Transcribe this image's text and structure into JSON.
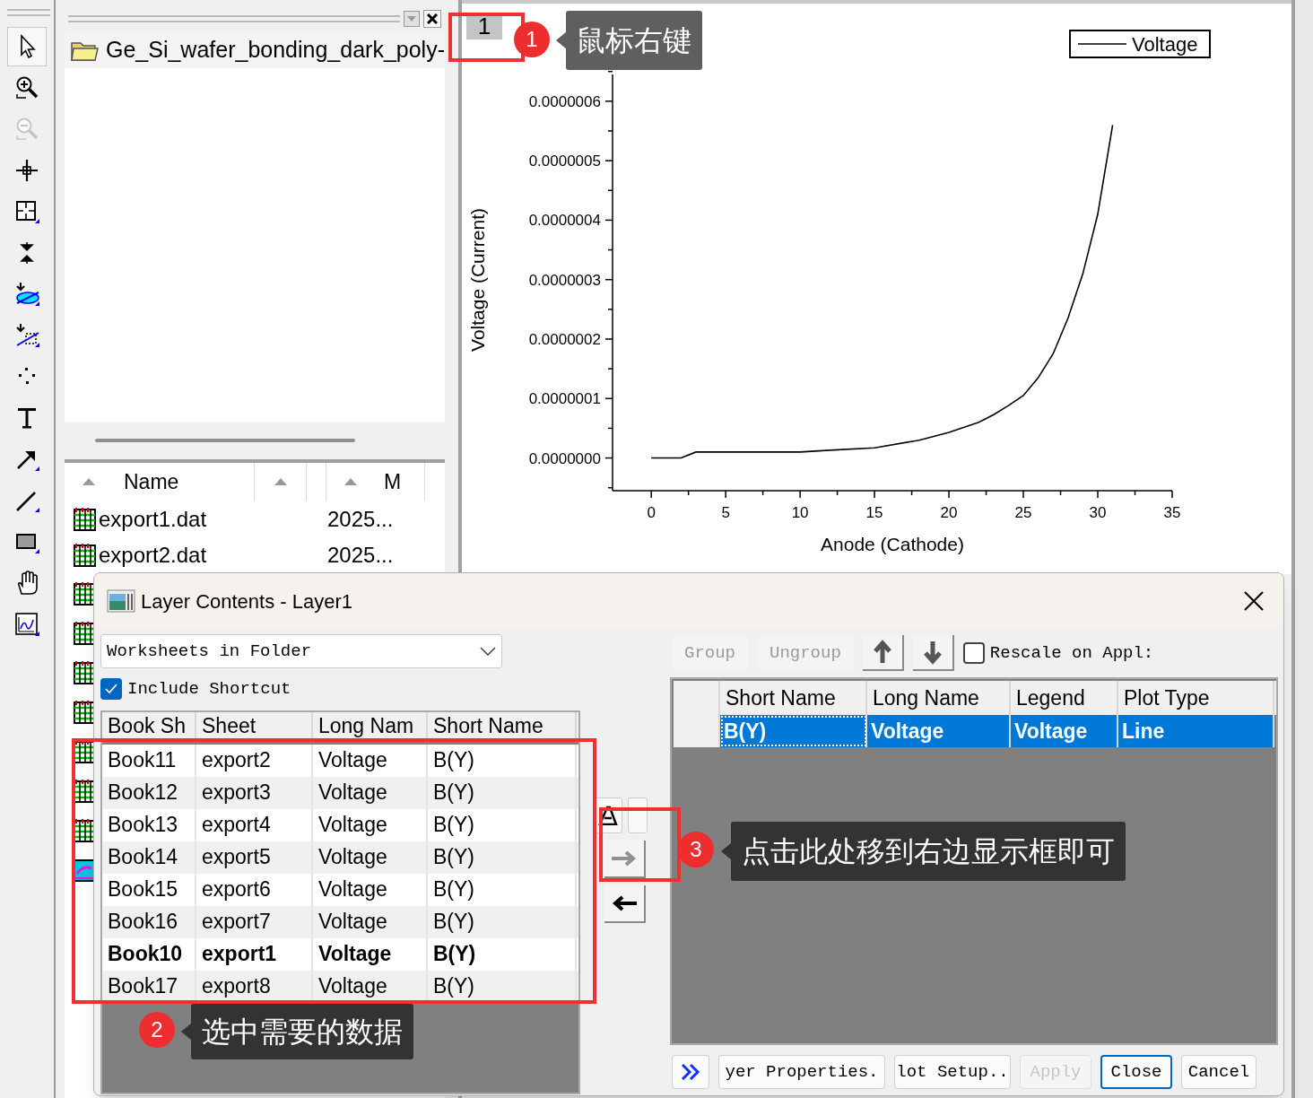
{
  "toolbar": {
    "tools": [
      {
        "kind": "pointer",
        "selected": true,
        "disabled": false
      },
      {
        "kind": "zoom_in",
        "selected": false,
        "disabled": false
      },
      {
        "kind": "zoom_out",
        "selected": false,
        "disabled": true
      },
      {
        "kind": "crosshair",
        "selected": false,
        "disabled": false
      },
      {
        "kind": "scale",
        "selected": false,
        "disabled": false
      },
      {
        "kind": "join",
        "selected": false,
        "disabled": false
      },
      {
        "kind": "ellipse",
        "selected": false,
        "disabled": false
      },
      {
        "kind": "region",
        "selected": false,
        "disabled": false
      },
      {
        "kind": "dots",
        "selected": false,
        "disabled": false
      },
      {
        "kind": "text",
        "selected": false,
        "disabled": false
      },
      {
        "kind": "arrow",
        "selected": false,
        "disabled": false
      },
      {
        "kind": "line",
        "selected": false,
        "disabled": false
      },
      {
        "kind": "rectangle",
        "selected": false,
        "disabled": false
      },
      {
        "kind": "hand",
        "selected": false,
        "disabled": false
      },
      {
        "kind": "chart",
        "selected": false,
        "disabled": false
      }
    ]
  },
  "project_explorer": {
    "folder": "Ge_Si_wafer_bonding_dark_poly-",
    "columns": [
      "Name",
      "M"
    ],
    "files": [
      {
        "name": "export1.dat",
        "modified": "2025..."
      },
      {
        "name": "export2.dat",
        "modified": "2025..."
      }
    ],
    "more_items": [
      {
        "kind": "worksheet"
      },
      {
        "kind": "worksheet"
      },
      {
        "kind": "worksheet"
      },
      {
        "kind": "worksheet"
      },
      {
        "kind": "worksheet"
      },
      {
        "kind": "worksheet"
      },
      {
        "kind": "worksheet"
      },
      {
        "kind": "graph"
      }
    ]
  },
  "graph": {
    "layer_tab": "1",
    "chart_data": {
      "type": "line",
      "xlabel": "Anode (Cathode)",
      "ylabel": "Voltage (Current)",
      "x": [
        0,
        2,
        3,
        5,
        10,
        12,
        15,
        18,
        20,
        22,
        23,
        24,
        25,
        26,
        27,
        28,
        29,
        30,
        31
      ],
      "series": [
        {
          "name": "Voltage",
          "color": "#000000",
          "values": [
            0,
            0,
            1e-08,
            1e-08,
            1e-08,
            1.3e-08,
            1.7e-08,
            3e-08,
            4.3e-08,
            6e-08,
            7.3e-08,
            8.8e-08,
            1.05e-07,
            1.35e-07,
            1.75e-07,
            2.35e-07,
            3.1e-07,
            4.1e-07,
            5.6e-07
          ]
        }
      ],
      "xlim": [
        -2.6,
        35
      ],
      "ylim": [
        -5.5e-08,
        6.45e-07
      ],
      "xticks": [
        0,
        5,
        10,
        15,
        20,
        25,
        30,
        35
      ],
      "yticks": [
        {
          "value": 0,
          "label": "0.0000000"
        },
        {
          "value": 1e-07,
          "label": "0.0000001"
        },
        {
          "value": 2e-07,
          "label": "0.0000002"
        },
        {
          "value": 3e-07,
          "label": "0.0000003"
        },
        {
          "value": 4e-07,
          "label": "0.0000004"
        },
        {
          "value": 5e-07,
          "label": "0.0000005"
        },
        {
          "value": 6e-07,
          "label": "0.0000006"
        }
      ]
    }
  },
  "dialog": {
    "title": "Layer Contents - Layer1",
    "source": "Worksheets in Folder",
    "include_shortcut": {
      "label": "Include Shortcut",
      "checked": true
    },
    "available": {
      "columns": [
        "Book Sh",
        "Sheet",
        "Long Nam",
        "Short Name"
      ],
      "rows": [
        {
          "cells": [
            "Book11",
            "export2",
            "Voltage",
            "B(Y)"
          ],
          "bold": false
        },
        {
          "cells": [
            "Book12",
            "export3",
            "Voltage",
            "B(Y)"
          ],
          "bold": false
        },
        {
          "cells": [
            "Book13",
            "export4",
            "Voltage",
            "B(Y)"
          ],
          "bold": false
        },
        {
          "cells": [
            "Book14",
            "export5",
            "Voltage",
            "B(Y)"
          ],
          "bold": false
        },
        {
          "cells": [
            "Book15",
            "export6",
            "Voltage",
            "B(Y)"
          ],
          "bold": false
        },
        {
          "cells": [
            "Book16",
            "export7",
            "Voltage",
            "B(Y)"
          ],
          "bold": false
        },
        {
          "cells": [
            "Book10",
            "export1",
            "Voltage",
            "B(Y)"
          ],
          "bold": true
        },
        {
          "cells": [
            "Book17",
            "export8",
            "Voltage",
            "B(Y)"
          ],
          "bold": false
        }
      ]
    },
    "transfer_buttons": [
      {
        "kind": "add",
        "disabled": true
      },
      {
        "kind": "remove",
        "disabled": false
      }
    ],
    "group_buttons": [
      {
        "label": "Group",
        "disabled": true
      },
      {
        "label": "Ungroup",
        "disabled": true
      }
    ],
    "order_buttons": [
      {
        "kind": "up"
      },
      {
        "kind": "down"
      }
    ],
    "rescale": {
      "label": "Rescale on Appl:",
      "checked": false
    },
    "plotted": {
      "columns": [
        "Short Name",
        "Long Name",
        "Legend",
        "Plot Type"
      ],
      "rows": [
        {
          "cells": [
            "B(Y)",
            "Voltage",
            "Voltage",
            "Line"
          ],
          "selected": true
        }
      ]
    },
    "footer_buttons": [
      {
        "kind": "expand",
        "disabled": false,
        "focused": false
      },
      {
        "kind": "text",
        "label": "yer Properties.",
        "disabled": false,
        "focused": false
      },
      {
        "kind": "text",
        "label": "lot Setup..",
        "disabled": false,
        "focused": false
      },
      {
        "kind": "text",
        "label": "Apply",
        "disabled": true,
        "focused": false
      },
      {
        "kind": "text",
        "label": "Close",
        "disabled": false,
        "focused": true
      },
      {
        "kind": "text",
        "label": "Cancel",
        "disabled": false,
        "focused": false
      }
    ]
  },
  "callouts": [
    {
      "number": "1",
      "text": "鼠标右键"
    },
    {
      "number": "2",
      "text": "选中需要的数据"
    },
    {
      "number": "3",
      "text": "点击此处移到右边显示框即可"
    }
  ]
}
